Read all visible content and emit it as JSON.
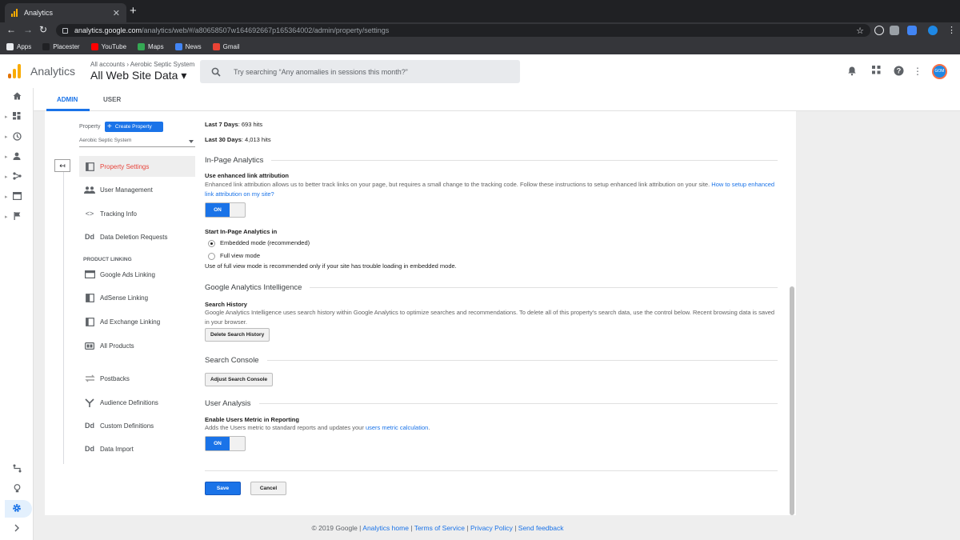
{
  "browser": {
    "tab_title": "Analytics",
    "tab_close": "✕",
    "new_tab": "+",
    "url_host": "analytics.google.com",
    "url_path": "/analytics/web/#/a80658507w164692667p165364002/admin/property/settings",
    "bookmarks": [
      {
        "label": "Apps",
        "color": "#e8eaed"
      },
      {
        "label": "Placester",
        "color": "#202124"
      },
      {
        "label": "YouTube",
        "color": "#ff0000"
      },
      {
        "label": "Maps",
        "color": "#34a853"
      },
      {
        "label": "News",
        "color": "#4285f4"
      },
      {
        "label": "Gmail",
        "color": "#ea4335"
      }
    ]
  },
  "header": {
    "app_name": "Analytics",
    "breadcrumb": "All accounts › Aerobic Septic System",
    "view_name": "All Web Site Data",
    "view_caret": "▾",
    "search_placeholder": "Try searching “Any anomalies in sessions this month?”",
    "avatar_text": "GOM"
  },
  "tabs": {
    "admin": "ADMIN",
    "user": "USER"
  },
  "property": {
    "label": "Property",
    "create_button": "Create Property",
    "create_plus": "+",
    "selected": "Aerobic Septic System",
    "back_arrow": "↤",
    "nav": [
      {
        "label": "Property Settings",
        "icon": "settings-doc-icon",
        "glyph": "▢",
        "active": true
      },
      {
        "label": "User Management",
        "icon": "users-icon",
        "glyph": "👥"
      },
      {
        "label": "Tracking Info",
        "icon": "code-icon",
        "glyph": "<>"
      },
      {
        "label": "Data Deletion Requests",
        "icon": "dd-icon",
        "glyph": "Dd"
      }
    ],
    "product_linking_heading": "PRODUCT LINKING",
    "product_nav": [
      {
        "label": "Google Ads Linking",
        "icon": "ads-icon",
        "glyph": "▤"
      },
      {
        "label": "AdSense Linking",
        "icon": "adsense-icon",
        "glyph": "▥"
      },
      {
        "label": "Ad Exchange Linking",
        "icon": "adexchange-icon",
        "glyph": "▢"
      },
      {
        "label": "All Products",
        "icon": "all-products-icon",
        "glyph": "⊡"
      }
    ],
    "other_nav": [
      {
        "label": "Postbacks",
        "icon": "postbacks-icon",
        "glyph": "⇄"
      },
      {
        "label": "Audience Definitions",
        "icon": "audience-icon",
        "glyph": "Y"
      },
      {
        "label": "Custom Definitions",
        "icon": "custom-def-icon",
        "glyph": "Dd"
      },
      {
        "label": "Data Import",
        "icon": "data-import-icon",
        "glyph": "Dd"
      }
    ]
  },
  "main": {
    "last7_label": "Last 7 Days",
    "last7_value": ": 693 hits",
    "last30_label": "Last 30 Days",
    "last30_value": ": 4,013 hits",
    "in_page": {
      "heading": "In-Page Analytics",
      "enhanced_title": "Use enhanced link attribution",
      "enhanced_desc": "Enhanced link attribution allows us to better track links on your page, but requires a small change to the tracking code. Follow these instructions to setup enhanced link attribution on your site.",
      "enhanced_link": "How to setup enhanced link attribution on my site?",
      "toggle_label": "ON",
      "start_title": "Start In-Page Analytics in",
      "option_embedded": "Embedded mode (recommended)",
      "option_full": "Full view mode",
      "note": "Use of full view mode is recommended only if your site has trouble loading in embedded mode."
    },
    "intelligence": {
      "heading": "Google Analytics Intelligence",
      "search_history_title": "Search History",
      "search_history_desc": "Google Analytics Intelligence uses search history within Google Analytics to optimize searches and recommendations. To delete all of this property's search data, use the control below. Recent browsing data is saved in your browser.",
      "delete_button": "Delete Search History"
    },
    "search_console": {
      "heading": "Search Console",
      "adjust_button": "Adjust Search Console"
    },
    "user_analysis": {
      "heading": "User Analysis",
      "enable_title": "Enable Users Metric in Reporting",
      "enable_desc": "Adds the Users metric to standard reports and updates your",
      "enable_link": "users metric calculation",
      "enable_end": ".",
      "toggle_label": "ON"
    },
    "save": "Save",
    "cancel": "Cancel"
  },
  "footer": {
    "copyright": "© 2019 Google | ",
    "links": [
      "Analytics home",
      "Terms of Service",
      "Privacy Policy",
      "Send feedback"
    ],
    "sep": " | "
  },
  "colors": {
    "accent": "#1a73e8",
    "active_nav": "#e8453c"
  }
}
